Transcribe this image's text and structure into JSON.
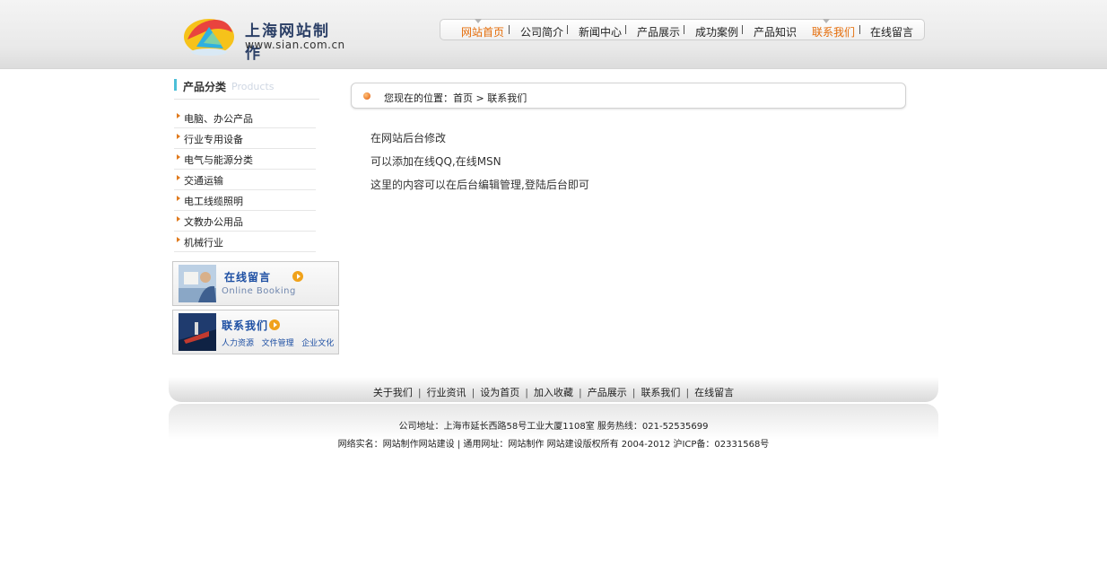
{
  "logo": {
    "title": "上海网站制作",
    "url": "www.sian.com.cn"
  },
  "nav": {
    "items": [
      {
        "label": "网站首页",
        "active": true
      },
      {
        "label": "公司简介",
        "active": false
      },
      {
        "label": "新闻中心",
        "active": false
      },
      {
        "label": "产品展示",
        "active": false
      },
      {
        "label": "成功案例",
        "active": false
      },
      {
        "label": "产品知识",
        "active": false
      },
      {
        "label": "联系我们",
        "active": true
      },
      {
        "label": "在线留言",
        "active": false
      }
    ]
  },
  "sidebar": {
    "title": "产品分类",
    "subtitle": "Products",
    "categories": [
      "电脑、办公产品",
      "行业专用设备",
      "电气与能源分类",
      "交通运输",
      "电工线缆照明",
      "文教办公用品",
      "机械行业"
    ],
    "promo_booking": {
      "title": "在线留言",
      "sub": "Online Booking"
    },
    "promo_contact": {
      "title": "联系我们",
      "links": [
        "人力资源",
        "文件管理",
        "企业文化"
      ]
    }
  },
  "breadcrumb": {
    "text": "您现在的位置：首页 > 联系我们"
  },
  "content": {
    "lines": [
      "在网站后台修改",
      "可以添加在线QQ,在线MSN",
      "这里的内容可以在后台编辑管理,登陆后台即可"
    ]
  },
  "footer": {
    "links": [
      "关于我们",
      "行业资讯",
      "设为首页",
      "加入收藏",
      "产品展示",
      "联系我们",
      "在线留言"
    ],
    "address": "公司地址：上海市延长西路58号工业大厦1108室 服务热线：021-52535699",
    "copyright": "网络实名：网站制作网站建设 | 通用网址：网站制作 网站建设版权所有 2004-2012 沪ICP备：02331568号"
  },
  "colors": {
    "accent": "#e46b07",
    "brand": "#2b3f66",
    "link": "#1d4fa3"
  }
}
